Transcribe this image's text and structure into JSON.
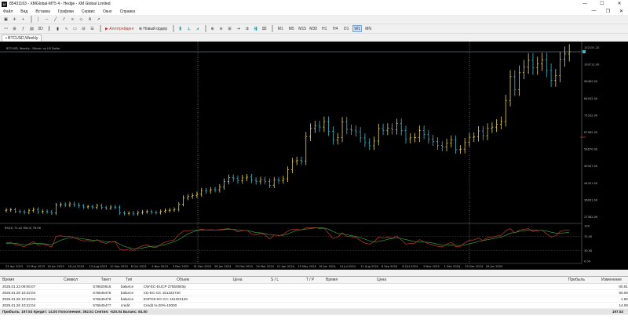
{
  "window": {
    "title": "85431163 - XMGlobal-MT5 4 - Hedge - XM Global Limited",
    "icon_letter": "M",
    "controls": [
      "—",
      "☐",
      "✕"
    ]
  },
  "menu": [
    "Файл",
    "Вид",
    "Вставка",
    "Графики",
    "Сервис",
    "Окно",
    "Справка"
  ],
  "toolbar": {
    "algotrading": "Алготрейдинг",
    "new_order": "Новый ордер",
    "timeframes": [
      "M1",
      "M5",
      "M15",
      "M30",
      "H1",
      "H4",
      "D1",
      "W1",
      "MN"
    ],
    "active_timeframe": "W1"
  },
  "chart": {
    "tab_label": "BTCUSD,Weekly",
    "legend": "BTCUSD, Weekly : Bitcoin vs US Dollar",
    "indicator_label": "RSI(3) 72.42 RSI(3) 76.96",
    "price_labels": [
      "102151.20",
      "100712.00",
      "96462.00",
      "84002.00",
      "75532.00",
      "67562.00",
      "58670.00",
      "49437.00",
      "44201.00",
      "36001.00",
      "27362.00"
    ],
    "rsi_labels": [
      "100",
      "70.00",
      "30.00",
      "0.00"
    ],
    "date_labels": [
      "23 Apr 2023",
      "21 May 2023",
      "18 Jun 2023",
      "16 Jul 2023",
      "13 Aug 2023",
      "10 Sep 2023",
      "8 Oct 2023",
      "5 Nov 2023",
      "3 Dec 2023",
      "31 Dec 2023",
      "28 Jan 2024",
      "25 Feb 2024",
      "24 Mar 2024",
      "21 Apr 2024",
      "19 May 2024",
      "16 Jun 2024",
      "14 Jul 2024",
      "11 Aug 2024",
      "8 Sep 2024",
      "6 Oct 2024",
      "3 Nov 2024",
      "1 Dec 2024",
      "29 Dec 2024",
      "26 Jan 2025"
    ],
    "colors": {
      "bull": "#e8d44d",
      "bear": "#3fb8c8",
      "rsi_main": "#c0392b",
      "rsi_signal": "#2e9e3a",
      "background": "#000000",
      "price_line": "#9ea8c8"
    }
  },
  "chart_data": {
    "type": "candlestick",
    "symbol": "BTCUSD",
    "period": "Weekly",
    "ylim": [
      22000,
      108000
    ],
    "closes": [
      27800,
      27900,
      27100,
      27000,
      26600,
      27500,
      28100,
      26900,
      27200,
      26900,
      26300,
      30200,
      30500,
      30200,
      30800,
      30300,
      29800,
      29300,
      29400,
      29100,
      29900,
      29000,
      28800,
      29300,
      29200,
      26400,
      26100,
      26300,
      25900,
      26500,
      26900,
      27100,
      26600,
      26500,
      27100,
      27600,
      27800,
      28100,
      30600,
      33800,
      34400,
      34900,
      35600,
      37300,
      37100,
      37800,
      37700,
      39100,
      41800,
      43700,
      43200,
      42100,
      43500,
      43900,
      42400,
      41700,
      42600,
      41800,
      39900,
      42500,
      42100,
      43100,
      47500,
      51600,
      52100,
      51700,
      63800,
      67900,
      69100,
      68400,
      71100,
      66400,
      62000,
      63300,
      70900,
      67300,
      66900,
      66100,
      63100,
      60800,
      59300,
      61600,
      67700,
      66800,
      67900,
      67100,
      70100,
      66700,
      62600,
      63200,
      63300,
      66800,
      64800,
      62500,
      61300,
      59400,
      58600,
      60600,
      62100,
      57400,
      57600,
      60900,
      63400,
      63600,
      66500,
      64200,
      67900,
      68400,
      69800,
      71100,
      81400,
      93100,
      86700,
      95200,
      97900,
      101100,
      97400,
      99400,
      101300,
      96200,
      91300,
      93600,
      101600,
      104200,
      105300
    ],
    "rsi_main": [
      52,
      53,
      46,
      44,
      40,
      49,
      55,
      45,
      48,
      45,
      40,
      70,
      72,
      69,
      71,
      66,
      61,
      57,
      58,
      55,
      61,
      53,
      50,
      55,
      54,
      33,
      31,
      34,
      30,
      38,
      43,
      46,
      40,
      38,
      47,
      54,
      57,
      60,
      75,
      85,
      86,
      87,
      88,
      90,
      88,
      89,
      88,
      89,
      91,
      92,
      89,
      83,
      86,
      87,
      78,
      74,
      79,
      74,
      63,
      74,
      72,
      76,
      85,
      90,
      90,
      88,
      94,
      95,
      95,
      92,
      93,
      78,
      64,
      68,
      80,
      70,
      69,
      67,
      58,
      51,
      48,
      55,
      68,
      65,
      68,
      65,
      71,
      60,
      48,
      50,
      51,
      61,
      55,
      49,
      46,
      42,
      40,
      48,
      53,
      41,
      42,
      52,
      59,
      60,
      66,
      58,
      67,
      68,
      71,
      73,
      86,
      92,
      80,
      88,
      90,
      92,
      84,
      86,
      88,
      77,
      68,
      72,
      84,
      87,
      88
    ],
    "rsi_signal": [
      50,
      51,
      50,
      48,
      46,
      47,
      50,
      50,
      49,
      48,
      46,
      53,
      59,
      63,
      66,
      66,
      65,
      63,
      61,
      59,
      59,
      57,
      55,
      55,
      55,
      48,
      42,
      38,
      35,
      35,
      37,
      40,
      42,
      42,
      44,
      47,
      51,
      55,
      61,
      69,
      77,
      82,
      86,
      88,
      88,
      88,
      88,
      88,
      89,
      90,
      90,
      88,
      87,
      87,
      84,
      81,
      80,
      78,
      74,
      74,
      73,
      73,
      77,
      82,
      87,
      89,
      91,
      92,
      94,
      94,
      94,
      90,
      84,
      78,
      77,
      75,
      72,
      70,
      66,
      62,
      57,
      54,
      56,
      58,
      62,
      64,
      66,
      64,
      61,
      58,
      55,
      55,
      54,
      53,
      51,
      48,
      45,
      45,
      46,
      45,
      44,
      46,
      49,
      52,
      56,
      58,
      61,
      63,
      66,
      68,
      73,
      79,
      81,
      84,
      86,
      88,
      88,
      87,
      87,
      85,
      82,
      79,
      79,
      80,
      82
    ],
    "series_labels": [
      "RSI(3) 72.42",
      "RSI(3) 76.96"
    ]
  },
  "terminal": {
    "columns": [
      "Время",
      "Символ",
      "Тикет",
      "Тип",
      "Объем",
      "Цена",
      "S / L",
      "T / P",
      "Время",
      "Цена",
      "Прибыль",
      "Изменение"
    ],
    "rows": [
      {
        "time": "2025.01.23 09:06:07",
        "symbol": "",
        "ticket": "578920616",
        "type": "balance",
        "comment": "CW-EC-EUCP 27550840p",
        "profit": "-30.51"
      },
      {
        "time": "2025.01.26 10:22:04",
        "symbol": "",
        "ticket": "576545475",
        "type": "balance",
        "comment": "CD-EC-CC 151322740",
        "profit": "60.00"
      },
      {
        "time": "2025.01.26 10:22:04",
        "symbol": "",
        "ticket": "576545476",
        "type": "balance",
        "comment": "EXPOS-EC-CC 151322140",
        "profit": "1.82"
      },
      {
        "time": "2025.01.26 10:22:04",
        "symbol": "",
        "ticket": "576545477",
        "type": "credit",
        "comment": "Credit In-20%-10000",
        "profit": "14.00"
      }
    ],
    "summary": "Прибыль: 197.53  Кредит: 14.00  Пополнения: 392.51  Снятия: -520.04  Баланс: 84.00",
    "summary_total": "197.53"
  }
}
